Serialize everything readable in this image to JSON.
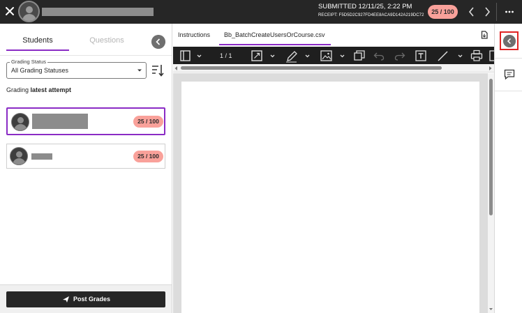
{
  "topbar": {
    "close_icon": "close-icon",
    "submitted_text": "SUBMITTED 12/11/25, 2:22 PM",
    "receipt_text": "RECEIPT: F5D5D2C927FD4EE8ACA9D142A219DC72",
    "grade": "25 / 100",
    "grade_color": "#f9a19a",
    "prev_icon": "chevron-left-icon",
    "next_icon": "chevron-right-icon",
    "more_icon": "more-horizontal-icon"
  },
  "left_panel": {
    "tabs": [
      {
        "label": "Students",
        "active": true
      },
      {
        "label": "Questions",
        "active": false
      }
    ],
    "grading_status": {
      "label": "Grading Status",
      "value": "All Grading Statuses"
    },
    "grading_note_prefix": "Grading ",
    "grading_note_bold": "latest attempt",
    "students": [
      {
        "grade": "25 / 100",
        "selected": true
      },
      {
        "grade": "25 / 100",
        "selected": false
      }
    ],
    "post_grades_label": "Post Grades"
  },
  "viewer": {
    "tabs": [
      {
        "label": "Instructions",
        "active": false
      },
      {
        "label": "Bb_BatchCreateUsersOrCourse.csv",
        "active": true
      }
    ],
    "page_indicator": "1 / 1",
    "accent_color": "#8a2bc5"
  },
  "right_rail": {
    "highlight_color": "#e02424"
  }
}
